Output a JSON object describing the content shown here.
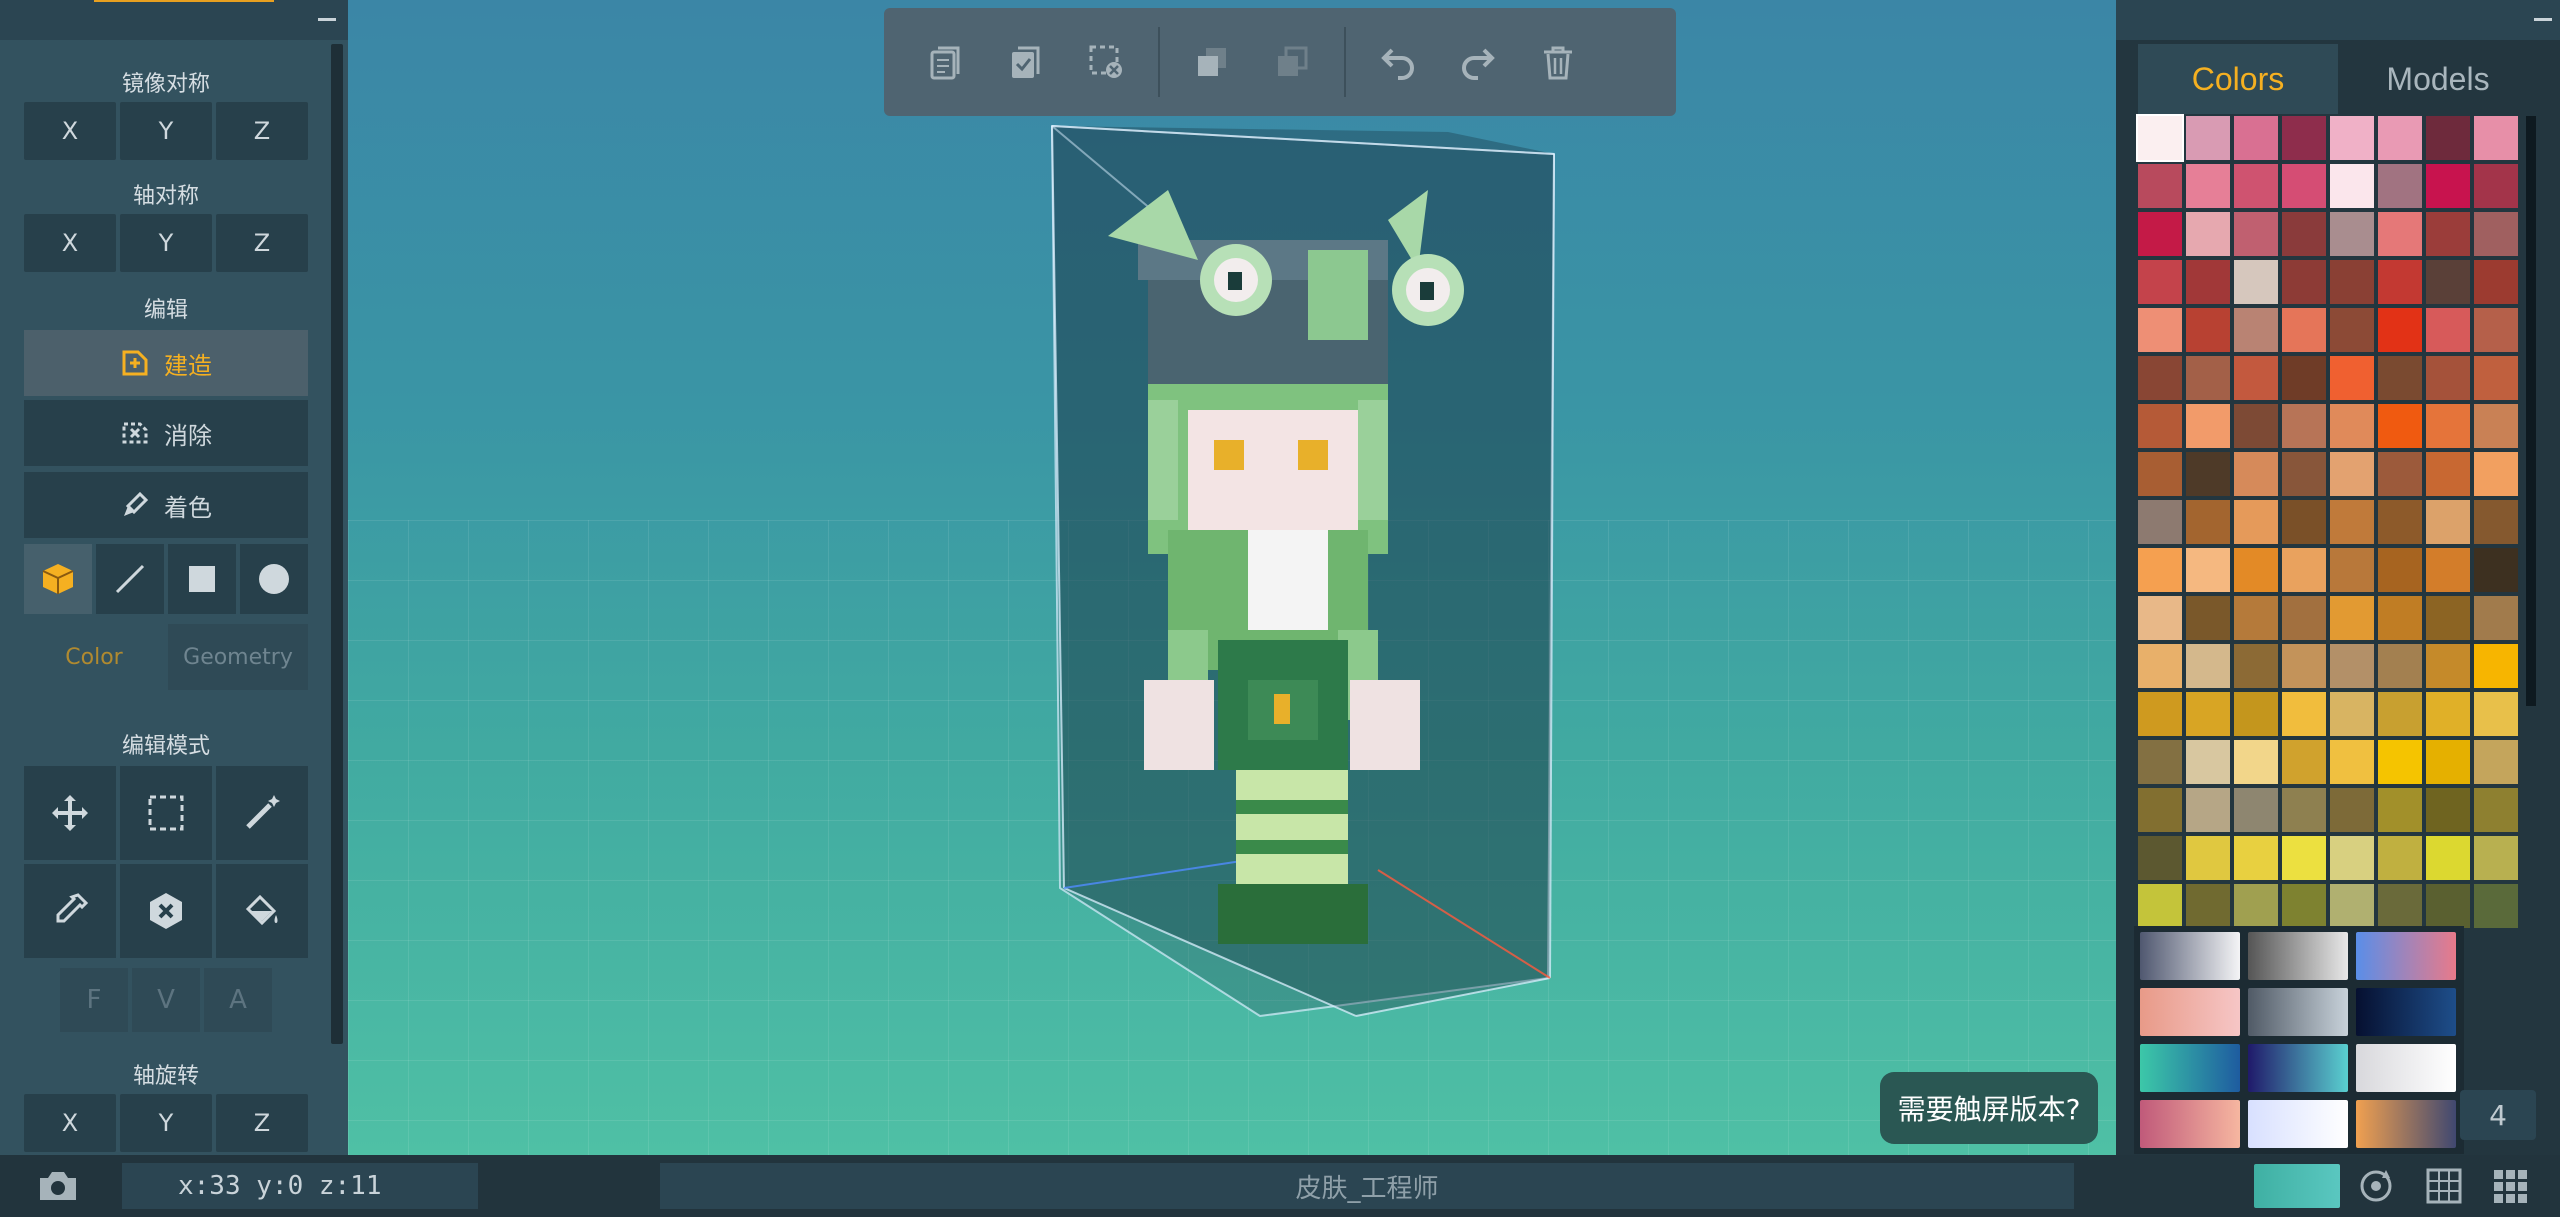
{
  "left_panel": {
    "mirror_title": "镜像对称",
    "mirror": [
      "X",
      "Y",
      "Z"
    ],
    "axis_sym_title": "轴对称",
    "axis_sym": [
      "X",
      "Y",
      "Z"
    ],
    "edit_title": "编辑",
    "build_label": "建造",
    "erase_label": "消除",
    "paint_label": "着色",
    "tab_color": "Color",
    "tab_geometry": "Geometry",
    "edit_mode_title": "编辑模式",
    "fva": [
      "F",
      "V",
      "A"
    ],
    "rotate_title": "轴旋转",
    "rotate": [
      "X",
      "Y",
      "Z"
    ]
  },
  "right_panel": {
    "tab_colors": "Colors",
    "tab_models": "Models",
    "palette": [
      "#fbeff0",
      "#d99bb3",
      "#d97092",
      "#8e2d4c",
      "#f0b1c7",
      "#e99ab4",
      "#6e2a3c",
      "#e78fa8",
      "#b84a5d",
      "#e67f97",
      "#cf5370",
      "#d54d74",
      "#fbe6ec",
      "#a17381",
      "#c8134e",
      "#a3344a",
      "#c41a47",
      "#e6a8af",
      "#c06070",
      "#8a3b3b",
      "#a98d8f",
      "#e57878",
      "#9b3d3a",
      "#a06060",
      "#c4434b",
      "#a13838",
      "#d6c7bd",
      "#8d3b36",
      "#8a4034",
      "#c33932",
      "#5a4038",
      "#9c3b30",
      "#ee8f75",
      "#b84132",
      "#b98373",
      "#e57559",
      "#8c4a36",
      "#e23216",
      "#d75a5a",
      "#b5604a",
      "#894634",
      "#a36048",
      "#c3593e",
      "#6f3c27",
      "#f06030",
      "#7a4a30",
      "#a5523a",
      "#c0603e",
      "#b55a37",
      "#f29b6a",
      "#7d4a35",
      "#b77457",
      "#e08a5a",
      "#f05a10",
      "#e5743a",
      "#c98155",
      "#a85e33",
      "#4e3a28",
      "#d68a5a",
      "#88563a",
      "#e3a270",
      "#9c5a3b",
      "#c86832",
      "#f2a060",
      "#8d7a70",
      "#a3652f",
      "#e59a5a",
      "#7a5028",
      "#c07a3a",
      "#8d5a2a",
      "#dca26a",
      "#85592f",
      "#f5a050",
      "#f5b880",
      "#e38a26",
      "#e9a25e",
      "#b8783a",
      "#a76420",
      "#d37d2a",
      "#3d3020",
      "#e8b888",
      "#7a582a",
      "#b57a3a",
      "#a2703f",
      "#e29a32",
      "#c07d24",
      "#8c6423",
      "#a17b4c",
      "#e8b06a",
      "#d4b88c",
      "#8c6a35",
      "#c3935a",
      "#b39068",
      "#a38050",
      "#c58a2a",
      "#f7b500",
      "#cf9a1f",
      "#d8a524",
      "#c4961d",
      "#f1bd3d",
      "#d8b462",
      "#c8a030",
      "#e0b028",
      "#e8c04a",
      "#837042",
      "#d8c7a0",
      "#f2d68a",
      "#d0a22d",
      "#f0c040",
      "#f5c400",
      "#e5b000",
      "#c4a55c",
      "#826f30",
      "#b6a686",
      "#8e8670",
      "#8e8050",
      "#7d6a38",
      "#a2902a",
      "#6f6420",
      "#8e8030",
      "#5c5830",
      "#e0c840",
      "#e8d040",
      "#ece040",
      "#d8d080",
      "#c0b040",
      "#dcd830",
      "#b8b050",
      "#c4c43a",
      "#706a30",
      "#a0a050",
      "#7e8230",
      "#b0b070",
      "#6a6a3a",
      "#5a6030",
      "#5a6a3a"
    ],
    "tool_number": "4"
  },
  "bottom_bar": {
    "coords": "x:33 y:0 z:11",
    "filename": "皮肤_工程师",
    "tooltip": "需要触屏版本?"
  }
}
